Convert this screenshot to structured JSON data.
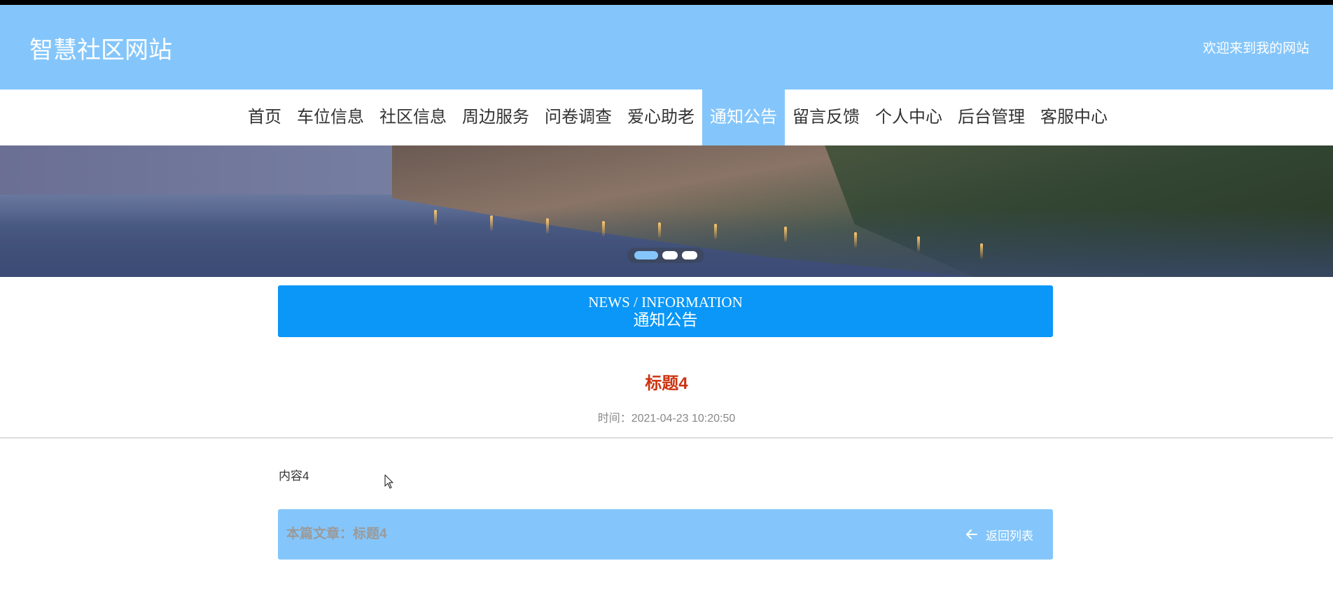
{
  "header": {
    "site_title": "智慧社区网站",
    "welcome": "欢迎来到我的网站"
  },
  "nav": {
    "items": [
      {
        "label": "首页"
      },
      {
        "label": "车位信息"
      },
      {
        "label": "社区信息"
      },
      {
        "label": "周边服务"
      },
      {
        "label": "问卷调查"
      },
      {
        "label": "爱心助老"
      },
      {
        "label": "通知公告",
        "active": true
      },
      {
        "label": "留言反馈"
      },
      {
        "label": "个人中心"
      },
      {
        "label": "后台管理"
      },
      {
        "label": "客服中心"
      }
    ]
  },
  "banner": {
    "slides": 3,
    "active_slide": 1
  },
  "section": {
    "title_en": "NEWS / INFORMATION",
    "title_cn": "通知公告"
  },
  "article": {
    "title": "标题4",
    "time": "时间：2021-04-23 10:20:50",
    "content": "内容4"
  },
  "footer": {
    "current_article": "本篇文章：标题4",
    "back_label": "返回列表"
  },
  "colors": {
    "header_bg": "#84c6fb",
    "section_bg": "#0a97f7",
    "title_red": "#cc3311"
  },
  "icons": {
    "back": "arrow-left-icon",
    "cursor": "mouse-pointer-icon"
  }
}
